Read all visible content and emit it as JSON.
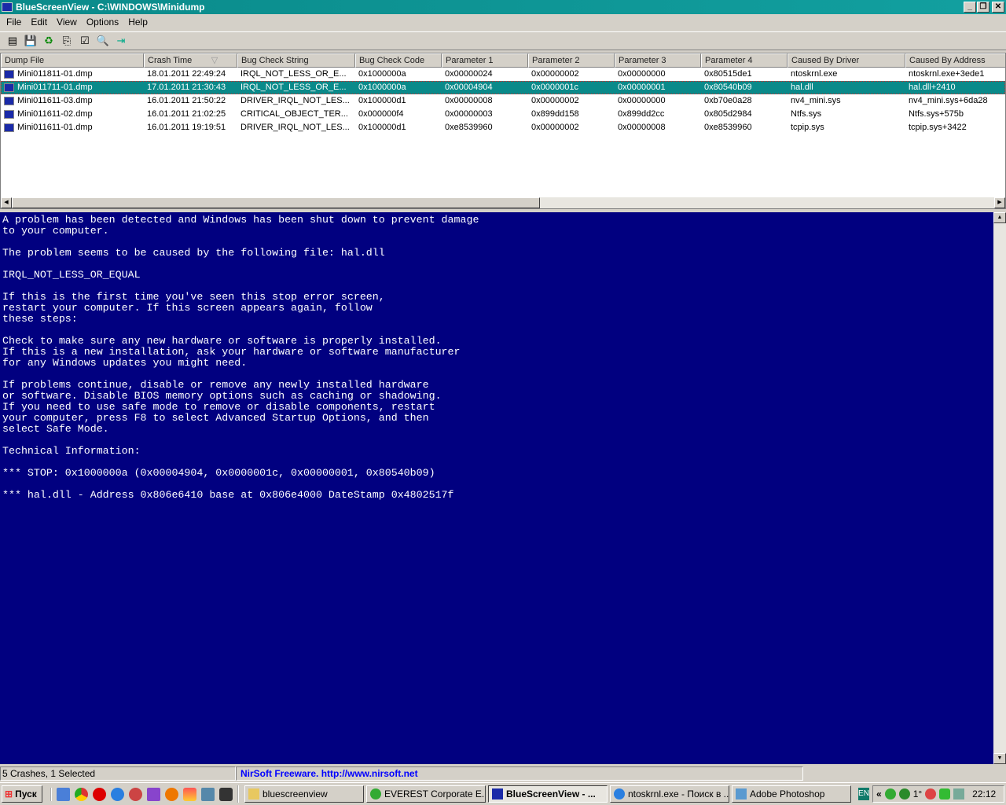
{
  "window": {
    "title": "BlueScreenView  -  C:\\WINDOWS\\Minidump",
    "min": "_",
    "max": "❐",
    "close": "✕"
  },
  "menu": [
    "File",
    "Edit",
    "View",
    "Options",
    "Help"
  ],
  "toolbar": [
    "properties",
    "save",
    "refresh",
    "copy",
    "options",
    "find",
    "exit"
  ],
  "columns": [
    "Dump File",
    "Crash Time",
    "Bug Check String",
    "Bug Check Code",
    "Parameter 1",
    "Parameter 2",
    "Parameter 3",
    "Parameter 4",
    "Caused By Driver",
    "Caused By Address"
  ],
  "sort_indicator": "▽",
  "rows": [
    [
      "Mini011811-01.dmp",
      "18.01.2011 22:49:24",
      "IRQL_NOT_LESS_OR_E...",
      "0x1000000a",
      "0x00000024",
      "0x00000002",
      "0x00000000",
      "0x80515de1",
      "ntoskrnl.exe",
      "ntoskrnl.exe+3ede1"
    ],
    [
      "Mini011711-01.dmp",
      "17.01.2011 21:30:43",
      "IRQL_NOT_LESS_OR_E...",
      "0x1000000a",
      "0x00004904",
      "0x0000001c",
      "0x00000001",
      "0x80540b09",
      "hal.dll",
      "hal.dll+2410"
    ],
    [
      "Mini011611-03.dmp",
      "16.01.2011 21:50:22",
      "DRIVER_IRQL_NOT_LES...",
      "0x100000d1",
      "0x00000008",
      "0x00000002",
      "0x00000000",
      "0xb70e0a28",
      "nv4_mini.sys",
      "nv4_mini.sys+6da28"
    ],
    [
      "Mini011611-02.dmp",
      "16.01.2011 21:02:25",
      "CRITICAL_OBJECT_TER...",
      "0x000000f4",
      "0x00000003",
      "0x899dd158",
      "0x899dd2cc",
      "0x805d2984",
      "Ntfs.sys",
      "Ntfs.sys+575b"
    ],
    [
      "Mini011611-01.dmp",
      "16.01.2011 19:19:51",
      "DRIVER_IRQL_NOT_LES...",
      "0x100000d1",
      "0xe8539960",
      "0x00000002",
      "0x00000008",
      "0xe8539960",
      "tcpip.sys",
      "tcpip.sys+3422"
    ]
  ],
  "selected_row": 1,
  "bsod_text": "A problem has been detected and Windows has been shut down to prevent damage\nto your computer.\n\nThe problem seems to be caused by the following file: hal.dll\n\nIRQL_NOT_LESS_OR_EQUAL\n\nIf this is the first time you've seen this stop error screen,\nrestart your computer. If this screen appears again, follow\nthese steps:\n\nCheck to make sure any new hardware or software is properly installed.\nIf this is a new installation, ask your hardware or software manufacturer\nfor any Windows updates you might need.\n\nIf problems continue, disable or remove any newly installed hardware\nor software. Disable BIOS memory options such as caching or shadowing.\nIf you need to use safe mode to remove or disable components, restart\nyour computer, press F8 to select Advanced Startup Options, and then\nselect Safe Mode.\n\nTechnical Information:\n\n*** STOP: 0x1000000a (0x00004904, 0x0000001c, 0x00000001, 0x80540b09)\n\n*** hal.dll - Address 0x806e6410 base at 0x806e4000 DateStamp 0x4802517f",
  "status": {
    "count": "5 Crashes, 1 Selected",
    "link": "NirSoft Freeware.  http://www.nirsoft.net",
    "link_color": "#0000ff"
  },
  "taskbar": {
    "start": "Пуск",
    "tasks": [
      "bluescreenview",
      "EVEREST Corporate E...",
      "BlueScreenView  - ...",
      "ntoskrnl.exe - Поиск в ...",
      "Adobe Photoshop"
    ],
    "active_task": 2,
    "lang": "EN",
    "tray_temp": "1°",
    "tray_chevron": "«",
    "clock": "22:12"
  }
}
